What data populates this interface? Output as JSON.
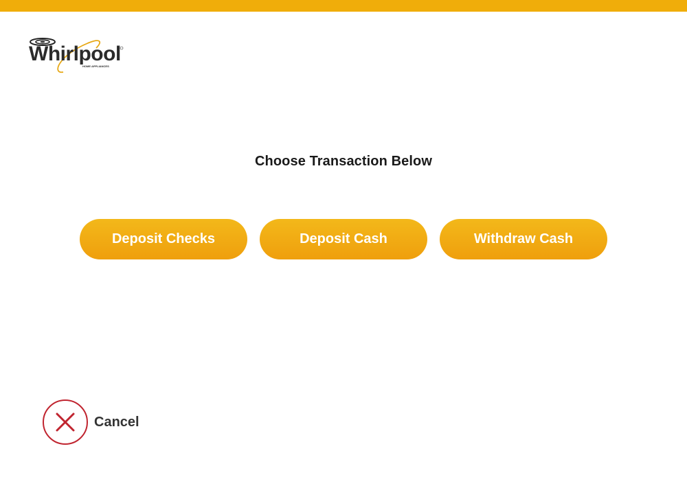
{
  "brand": {
    "name": "Whirlpool",
    "tagline": "HOME APPLIANCES",
    "accent_color": "#f0ad0a",
    "logo_icon": "whirlpool-logo-icon"
  },
  "main": {
    "heading": "Choose Transaction Below",
    "buttons": [
      {
        "label": "Deposit Checks"
      },
      {
        "label": "Deposit Cash"
      },
      {
        "label": "Withdraw Cash"
      }
    ]
  },
  "cancel": {
    "label": "Cancel",
    "icon": "close-icon",
    "color": "#c0242f"
  }
}
